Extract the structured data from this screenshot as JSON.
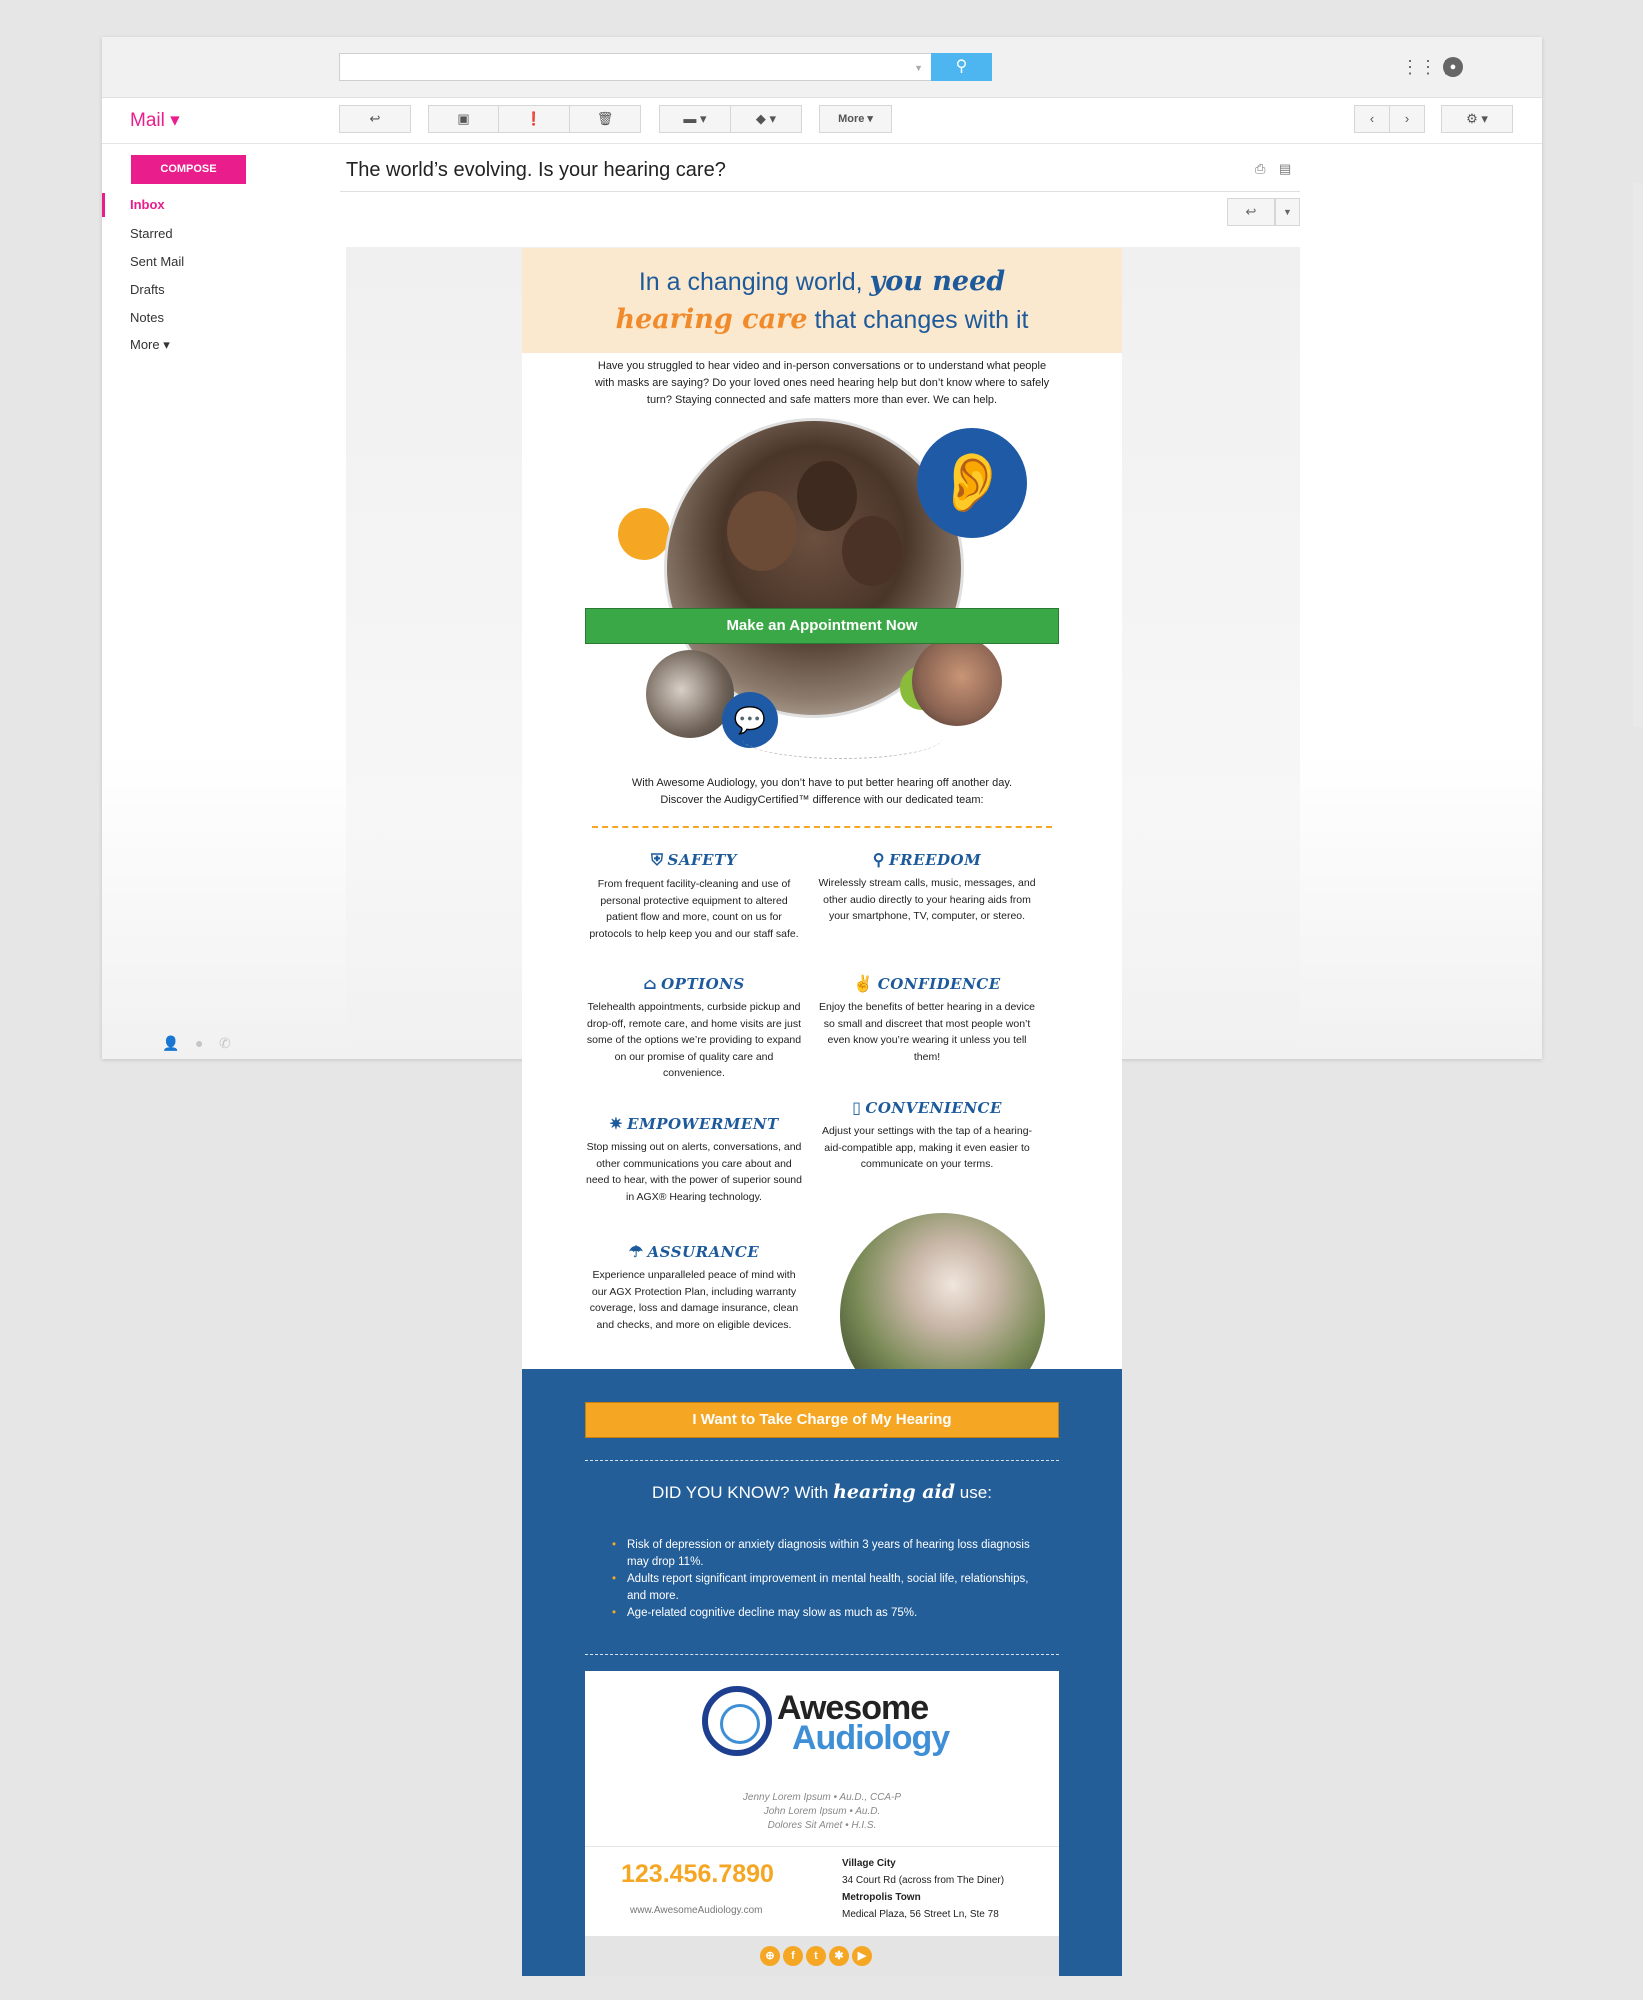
{
  "gmail": {
    "mail_label": "Mail ▾",
    "compose": "COMPOSE",
    "nav": [
      "Inbox",
      "Starred",
      "Sent Mail",
      "Drafts",
      "Notes",
      "More ▾"
    ],
    "toolbar": {
      "more": "More ▾"
    },
    "subject": "The world’s evolving. Is your hearing care?"
  },
  "email": {
    "headline_pre": "In a changing world, ",
    "headline_em": "you need",
    "headline2_em": "hearing care",
    "headline2_post": " that changes with it",
    "intro": "Have you struggled to hear video and in-person conversations or to understand what people with masks are saying? Do your loved ones need hearing help but don’t know where to safely turn? Staying connected and safe matters more than ever. We can help.",
    "cta_primary": "Make an Appointment Now",
    "lead_line1": "With Awesome Audiology, you don’t have to put better hearing off another day.",
    "lead_line2": "Discover the AudigyCertified™ difference with our dedicated team:",
    "features": [
      {
        "icon": "shield-icon",
        "title": "SAFETY",
        "body": "From frequent facility-cleaning and use of personal protective equipment to altered patient flow and more, count on us for protocols to help keep you and our staff safe."
      },
      {
        "icon": "location-pin-icon",
        "title": "FREEDOM",
        "body": "Wirelessly stream calls, music, messages, and other audio directly to your hearing aids from your smartphone, TV, computer, or stereo."
      },
      {
        "icon": "clinic-icon",
        "title": "OPTIONS",
        "body": "Telehealth appointments, curbside pickup and drop-off, remote care, and home visits are just some of the options we’re providing to expand on our promise of quality care and convenience."
      },
      {
        "icon": "peace-hand-icon",
        "title": "CONFIDENCE",
        "body": "Enjoy the benefits of better hearing in a device so small and discreet that most people won’t even know you’re wearing it unless you tell them!"
      },
      {
        "icon": "confetti-icon",
        "title": "EMPOWERMENT",
        "body": "Stop missing out on alerts, conversations, and other communications you care about and need to hear, with the power of superior sound in AGX® Hearing technology."
      },
      {
        "icon": "phone-app-icon",
        "title": "CONVENIENCE",
        "body": "Adjust your settings with the tap of a hearing-aid-compatible app, making it even easier to communicate on your terms."
      },
      {
        "icon": "umbrella-icon",
        "title": "ASSURANCE",
        "body": "Experience unparalleled peace of mind with our AGX Protection Plan, including warranty coverage, loss and damage insurance, clean and checks, and more on eligible devices."
      }
    ],
    "cta_secondary": "I Want to Take Charge of My Hearing",
    "dyk_pre": "DID YOU KNOW? With ",
    "dyk_em": "hearing aid",
    "dyk_post": " use:",
    "facts": [
      "Risk of depression or anxiety diagnosis within 3 years of hearing loss diagnosis may drop 11%.",
      "Adults report significant improvement in mental health, social life, relationships, and more.",
      "Age-related cognitive decline may slow as much as 75%."
    ],
    "logo_line1": "Awesome",
    "logo_line2": "Audiology",
    "staff": [
      "Jenny Lorem Ipsum • Au.D., CCA-P",
      "John Lorem Ipsum • Au.D.",
      "Dolores Sit Amet • H.I.S."
    ],
    "phone": "123.456.7890",
    "website": "www.AwesomeAudiology.com",
    "locations": [
      {
        "city": "Village City",
        "address": "34 Court Rd (across from The Diner)"
      },
      {
        "city": "Metropolis Town",
        "address": "Medical Plaza, 56 Street Ln, Ste 78"
      }
    ],
    "social_icons": [
      "link-icon",
      "facebook-icon",
      "twitter-icon",
      "yelp-icon",
      "youtube-icon"
    ]
  }
}
